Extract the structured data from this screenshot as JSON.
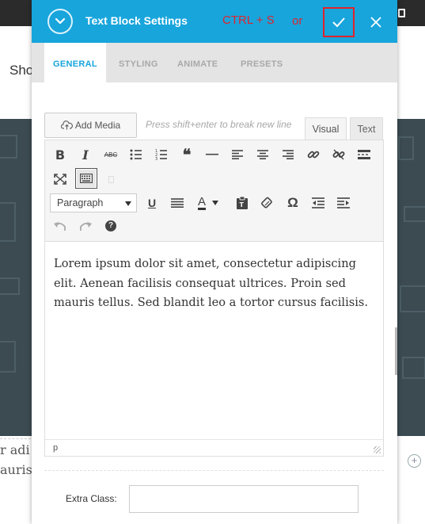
{
  "background": {
    "partial_nav_text": "Sho",
    "partial_text_lines": [
      "r adi",
      "auris"
    ]
  },
  "header": {
    "title": "Text Block Settings",
    "shortcut_hint": "CTRL + S",
    "shortcut_or": "or",
    "accent_color": "#18a5dc",
    "annotation_color": "#e0242c"
  },
  "tabs": [
    {
      "label": "GENERAL",
      "active": true
    },
    {
      "label": "STYLING",
      "active": false
    },
    {
      "label": "ANIMATE",
      "active": false
    },
    {
      "label": "PRESETS",
      "active": false
    }
  ],
  "editor": {
    "add_media_label": "Add Media",
    "placeholder_hint": "Press shift+enter to break new line",
    "mode_visual": "Visual",
    "mode_text": "Text",
    "format_select_value": "Paragraph",
    "content": "Lorem ipsum dolor sit amet, consectetur adipiscing elit. Aenean facilisis consequat ultrices. Proin sed mauris tellus. Sed blandit leo a tortor cursus facilisis.",
    "status_path": "p",
    "toolbar_row1_icons": [
      "bold-icon",
      "italic-icon",
      "strikethrough-icon",
      "bullet-list-icon",
      "numbered-list-icon",
      "blockquote-icon",
      "horizontal-line-icon",
      "align-left-icon",
      "align-center-icon",
      "align-right-icon",
      "link-icon",
      "unlink-icon",
      "read-more-icon"
    ],
    "toolbar_row2_icons": [
      "fullscreen-icon",
      "toolbar-toggle-icon"
    ],
    "toolbar_row3_icons": [
      "underline-icon",
      "justify-icon",
      "text-color-icon",
      "paste-text-icon",
      "clear-formatting-icon",
      "special-character-icon",
      "outdent-icon",
      "indent-icon"
    ],
    "toolbar_row4_icons": [
      "undo-icon",
      "redo-icon",
      "help-icon"
    ],
    "icon_glyphs": {
      "bold": "B",
      "italic": "I",
      "strike": "ABC",
      "quote": "❝",
      "hr": "—",
      "omega": "Ω",
      "underline": "U",
      "textcolor": "A",
      "help": "?"
    }
  },
  "extra_class": {
    "label": "Extra Class:",
    "value": ""
  }
}
